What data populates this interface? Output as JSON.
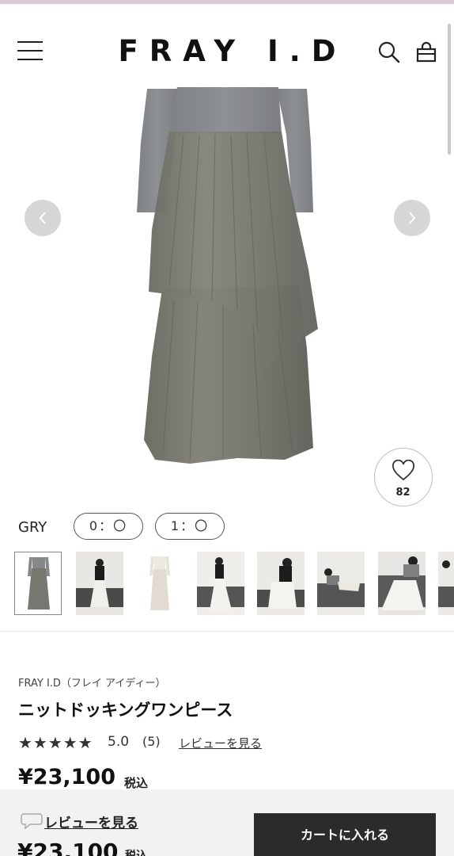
{
  "header": {
    "logo": "FRAY I.D"
  },
  "product": {
    "favorite_count": "82",
    "color_label": "GRY",
    "sizes": [
      "0：〇",
      "1：〇"
    ],
    "brand": "FRAY I.D（フレイ アイディー）",
    "name": "ニットドッキングワンピース",
    "stars": "★★★★★",
    "rating_score": "5.0",
    "rating_count": "(5)",
    "review_link": "レビューを見る",
    "price": "¥23,100",
    "tax_label": "税込"
  },
  "bottom_bar": {
    "review_link": "レビューを見る",
    "price": "¥23,100",
    "tax_label": "税込",
    "cart_button": "カートに入れる"
  },
  "colors": {
    "accent_dark": "#2b2b2b",
    "top_strip": "#dcc8d2",
    "dress_gray": "#7a7a74"
  }
}
